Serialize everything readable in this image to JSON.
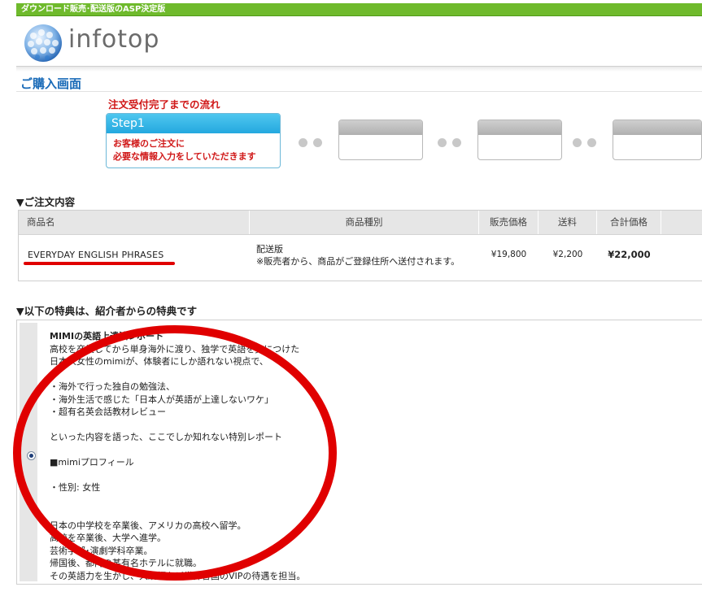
{
  "top_banner": "ダウンロード販売･配送版のASP決定版",
  "logo": {
    "text": "infotop"
  },
  "page_title": "ご購入画面",
  "flow": {
    "title": "注文受付完了までの流れ",
    "step1_label": "Step1",
    "step1_text_line1": "お客様のご注文に",
    "step1_text_line2": "必要な情報入力をしていただきます"
  },
  "order": {
    "heading": "▼ご注文内容",
    "columns": [
      "商品名",
      "商品種別",
      "販売価格",
      "送料",
      "合計価格"
    ],
    "row": {
      "product_name": "EVERYDAY ENGLISH PHRASES",
      "type_line1": "配送版",
      "type_line2": "※販売者から、商品がご登録住所へ送付されます。",
      "price": "¥19,800",
      "shipping": "¥2,200",
      "total": "¥22,000"
    }
  },
  "bonus": {
    "heading": "▼以下の特典は、紹介者からの特典です",
    "title": "MIMIの英語上達法レポート",
    "lines": [
      "高校を卒業してから単身海外に渡り、独学で英語を身につけた",
      "日本人女性のmimiが、体験者にしか語れない視点で、",
      "",
      "・海外で行った独自の勉強法、",
      "・海外生活で感じた「日本人が英語が上達しないワケ」",
      "・超有名英会話教材レビュー",
      "",
      "といった内容を語った、ここでしか知れない特別レポート",
      "",
      "■mimiプロフィール",
      "",
      "・性別: 女性",
      "",
      "",
      "日本の中学校を卒業後、アメリカの高校へ留学。",
      "高校を卒業後、大学へ進学。",
      "芸術学部･演劇学科卒業。",
      "帰国後、都内の某有名ホテルに就職。",
      "その英語力を生かし、大統領など世界各国のVIPの待遇を担当。"
    ]
  },
  "colors": {
    "banner_green": "#6fba2c",
    "title_blue": "#1a6bb8",
    "accent_red": "#d01818",
    "step_blue": "#24a8df",
    "annotation_red": "#e00000"
  }
}
